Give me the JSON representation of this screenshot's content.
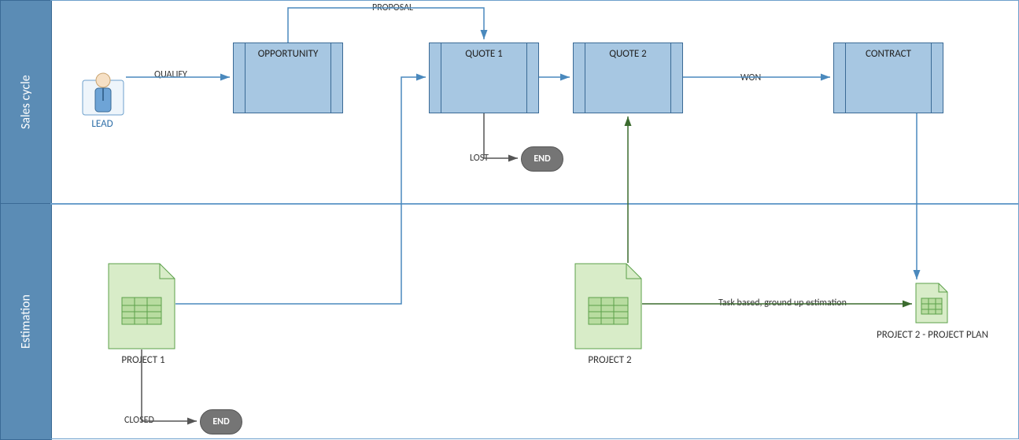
{
  "lanes": {
    "sales": "Sales cycle",
    "estimation": "Estimation"
  },
  "nodes": {
    "lead": "LEAD",
    "opportunity": "OPPORTUNITY",
    "quote1": "QUOTE 1",
    "quote2": "QUOTE 2",
    "contract": "CONTRACT",
    "end_lost": "END",
    "end_closed": "END",
    "project1": "PROJECT 1",
    "project2": "PROJECT 2",
    "project2_plan": "PROJECT 2 - PROJECT PLAN"
  },
  "edges": {
    "qualify": "QUALIFY",
    "proposal": "PROPOSAL",
    "lost": "LOST",
    "won": "WON",
    "closed": "CLOSED",
    "task_based": "Task based, ground up estimation"
  }
}
